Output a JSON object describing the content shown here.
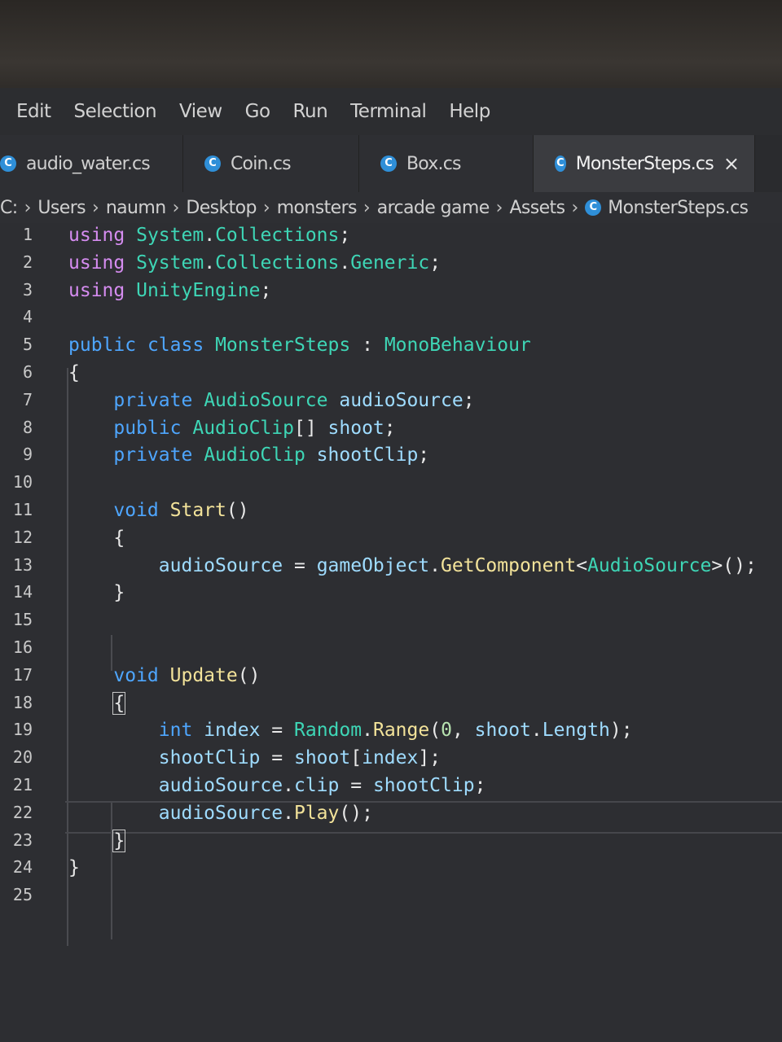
{
  "menu": [
    "Edit",
    "Selection",
    "View",
    "Go",
    "Run",
    "Terminal",
    "Help"
  ],
  "tabs": [
    {
      "label": "audio_water.cs",
      "active": false
    },
    {
      "label": "Coin.cs",
      "active": false
    },
    {
      "label": "Box.cs",
      "active": false
    },
    {
      "label": "MonsterSteps.cs",
      "active": true
    }
  ],
  "tab_close_symbol": "×",
  "breadcrumb": [
    "C:",
    "Users",
    "naumn",
    "Desktop",
    "monsters",
    "arcade game",
    "Assets",
    "MonsterSteps.cs"
  ],
  "code_lines": [
    "using System.Collections;",
    "using System.Collections.Generic;",
    "using UnityEngine;",
    "",
    "public class MonsterSteps : MonoBehaviour",
    "{",
    "    private AudioSource audioSource;",
    "    public AudioClip[] shoot;",
    "    private AudioClip shootClip;",
    "",
    "    void Start()",
    "    {",
    "        audioSource = gameObject.GetComponent<AudioSource>();",
    "    }",
    "",
    "",
    "    void Update()",
    "    {",
    "        int index = Random.Range(0, shoot.Length);",
    "        shootClip = shoot[index];",
    "        audioSource.clip = shootClip;",
    "        audioSource.Play();",
    "    }",
    "}",
    ""
  ],
  "current_line": 22,
  "colors": {
    "keyword": "#4ea6ff",
    "control_keyword": "#d58cf0",
    "type": "#3ed6b6",
    "function": "#f3e39a",
    "variable": "#9fdcff",
    "csharp_icon": "#2f8fd8"
  },
  "icons": {
    "file_icon": "csharp-icon",
    "close_icon": "close-icon",
    "separator": "chevron-right-icon"
  }
}
